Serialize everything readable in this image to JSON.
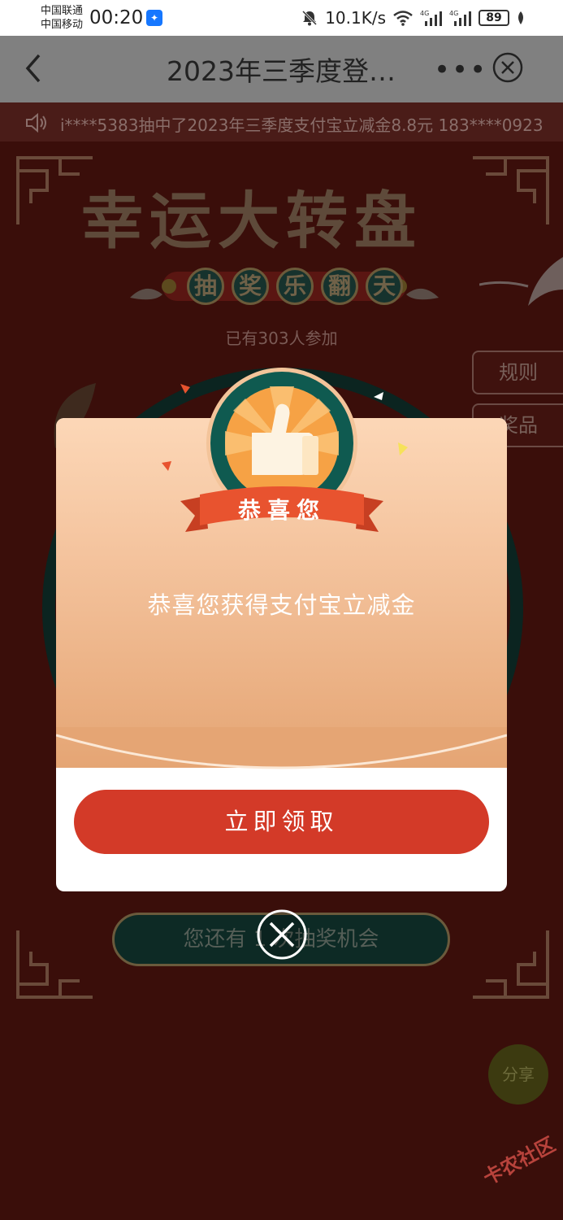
{
  "status_bar": {
    "carrier1": "中国联通",
    "carrier2": "中国移动",
    "time": "00:20",
    "net_speed": "10.1K/s",
    "battery": "89",
    "signal_label1": "4G",
    "signal_label2": "4G"
  },
  "title_bar": {
    "title": "2023年三季度登…"
  },
  "page": {
    "marquee": "i****5383抽中了2023年三季度支付宝立减金8.8元 183****0923",
    "game_title": "幸运大转盘",
    "subtitle_chars": [
      "抽",
      "奖",
      "乐",
      "翻",
      "天"
    ],
    "participants": "已有303人参加",
    "rules_label": "规则",
    "prizes_label": "奖品",
    "draw_chance": "您还有 1 次抽奖机会",
    "share_label": "分享",
    "watermark": "卡农社区"
  },
  "modal": {
    "ribbon_label": "恭喜您",
    "message": "恭喜您获得支付宝立减金",
    "claim_button": "立即领取"
  },
  "colors": {
    "primary_red": "#d33a28",
    "ribbon_red": "#e8532f",
    "badge_teal": "#0f5a50",
    "modal_gradient_top": "#fcd7b7",
    "modal_gradient_bottom": "#e5a574"
  }
}
